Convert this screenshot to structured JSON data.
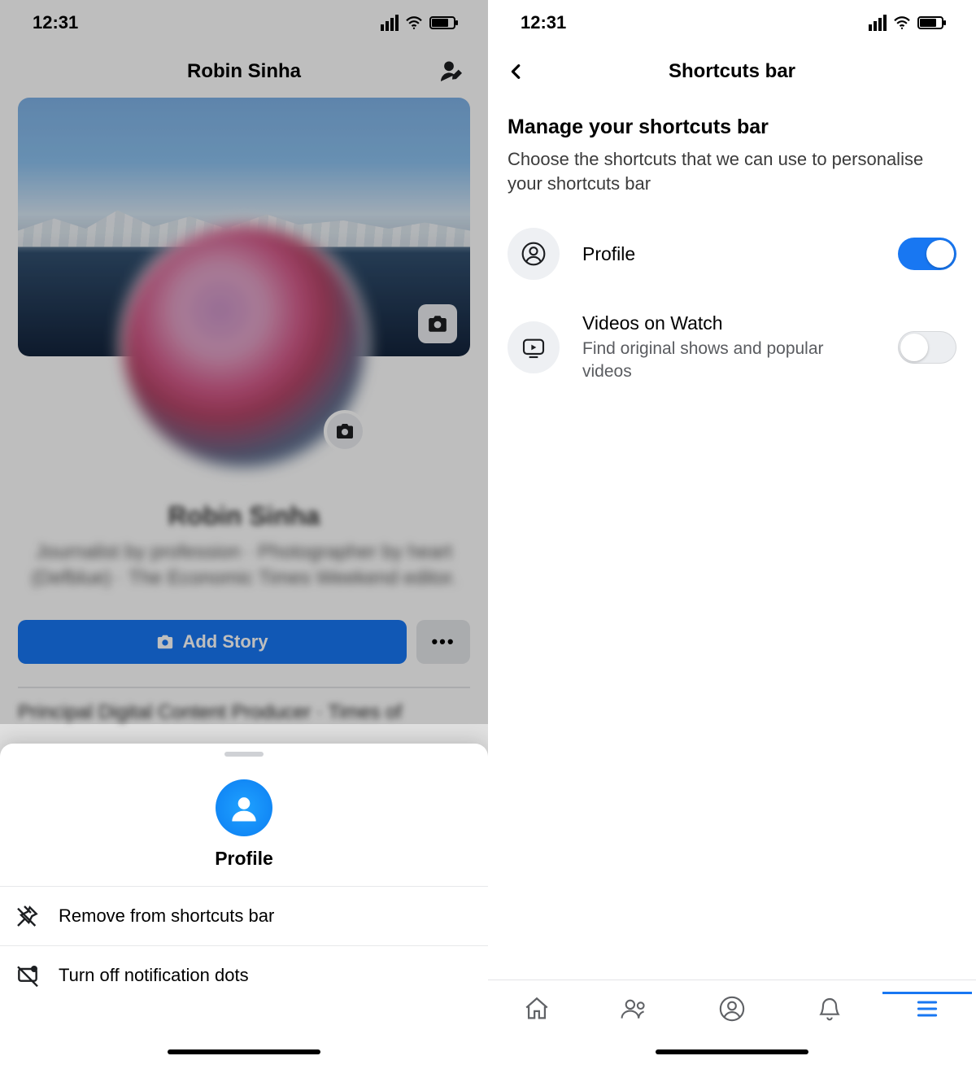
{
  "status": {
    "time": "12:31"
  },
  "left": {
    "header_title": "Robin Sinha",
    "add_story_label": "Add Story",
    "more_label": "•••",
    "profile_name": "Robin Sinha",
    "profile_bio": "Journalist by profession · Photographer by heart  (Defblue) · The Economic Times Weekend editor.",
    "job_line": "Principal Digital Content Producer · Times of",
    "sheet": {
      "title": "Profile",
      "item_remove": "Remove from shortcuts bar",
      "item_turn_off": "Turn off notification dots"
    }
  },
  "right": {
    "header_title": "Shortcuts bar",
    "section_title": "Manage your shortcuts bar",
    "section_sub": "Choose the shortcuts that we can use to personalise your shortcuts bar",
    "options": {
      "profile": {
        "title": "Profile",
        "on": true
      },
      "watch": {
        "title": "Videos on Watch",
        "sub": "Find original shows and popular videos",
        "on": false
      }
    }
  }
}
